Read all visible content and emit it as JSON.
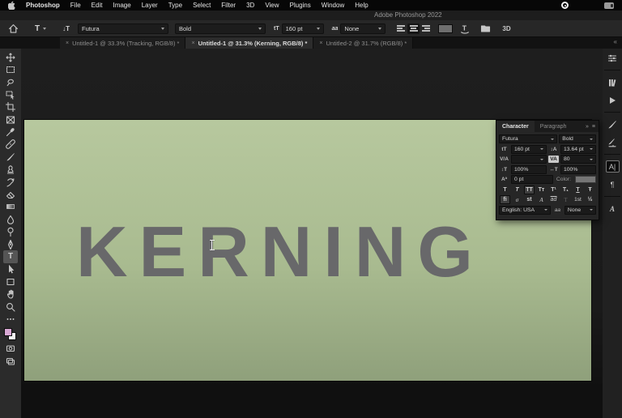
{
  "menubar": {
    "items": [
      "Photoshop",
      "File",
      "Edit",
      "Image",
      "Layer",
      "Type",
      "Select",
      "Filter",
      "3D",
      "View",
      "Plugins",
      "Window",
      "Help"
    ]
  },
  "titlebar": {
    "title": "Adobe Photoshop 2022"
  },
  "options_bar": {
    "font_family": "Futura",
    "font_style": "Bold",
    "font_size": "160 pt",
    "anti_alias": "None",
    "threed_label": "3D"
  },
  "tabs": [
    {
      "close": "×",
      "label": "Untitled-1 @ 33.3% (Tracking, RGB/8) *"
    },
    {
      "close": "×",
      "label": "Untitled-1 @ 31.3% (Kerning, RGB/8) *"
    },
    {
      "close": "×",
      "label": "Untitled-2 @ 31.7% (RGB/8) *"
    }
  ],
  "glyphs": {
    "collapse": "«",
    "panel_arrows": "»",
    "panel_menu": "≡",
    "type_tool": "T",
    "orientation": "↓T",
    "size_icon": "tT",
    "anti_alias_icon": "aa",
    "leading_icon": "↕A",
    "kerning_icon": "V/A",
    "tracking_icon": "VA",
    "vscale_icon": "↕T",
    "hscale_icon": "↔T",
    "baseline_icon": "Aª",
    "character_icon": "A|",
    "paragraph_icon": "¶",
    "glyphs_icon": "A"
  },
  "canvas": {
    "text": "KERNING"
  },
  "character_panel": {
    "tab_character": "Character",
    "tab_paragraph": "Paragraph",
    "font_family": "Futura",
    "font_style": "Bold",
    "size": "160 pt",
    "leading": "13.64 pt",
    "kerning": "",
    "tracking": "80",
    "vertical_scale": "100%",
    "horizontal_scale": "100%",
    "baseline_shift": "0 pt",
    "color_label": "Color:",
    "faux_styles": [
      "T",
      "T",
      "TT",
      "Tᴛ",
      "T¹",
      "T₁",
      "T",
      "Ŧ"
    ],
    "opentype": [
      "fi",
      "σ",
      "st",
      "A",
      "ad",
      "T",
      "1st",
      "½"
    ],
    "language": "English: USA",
    "anti_alias": "None"
  }
}
